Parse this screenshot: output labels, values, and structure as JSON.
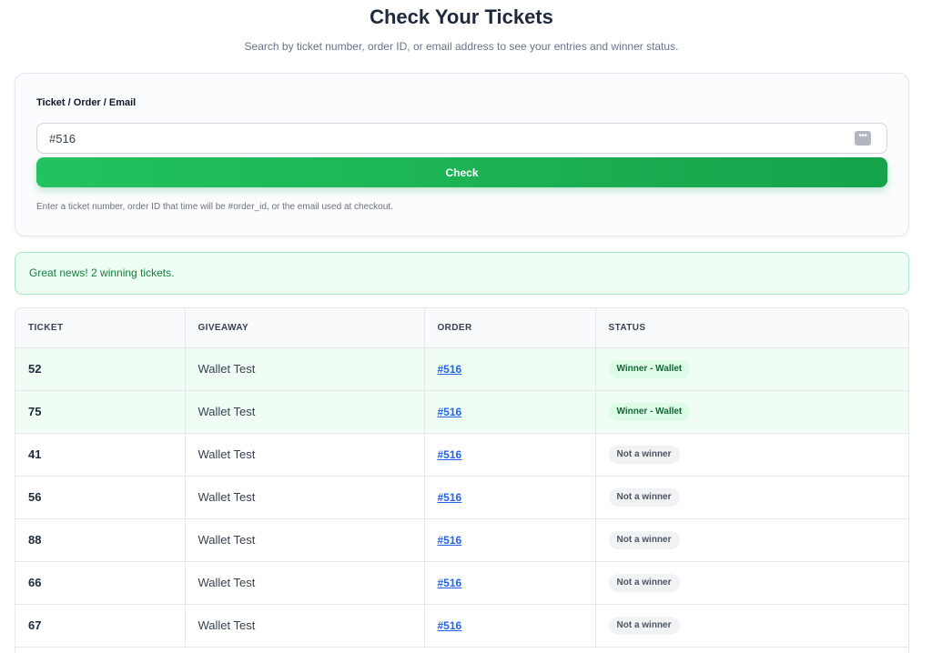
{
  "header": {
    "title": "Check Your Tickets",
    "subtitle": "Search by ticket number, order ID, or email address to see your entries and winner status."
  },
  "search": {
    "label": "Ticket / Order / Email",
    "value": "#516",
    "button_label": "Check",
    "hint": "Enter a ticket number, order ID that time will be #order_id, or the email used at checkout.",
    "icon": "dots-icon"
  },
  "alert": {
    "message": "Great news! 2 winning tickets."
  },
  "table": {
    "columns": [
      "TICKET",
      "GIVEAWAY",
      "ORDER",
      "STATUS"
    ],
    "rows": [
      {
        "ticket": "52",
        "giveaway": "Wallet Test",
        "order": "#516",
        "status": "Winner - Wallet",
        "winner": true
      },
      {
        "ticket": "75",
        "giveaway": "Wallet Test",
        "order": "#516",
        "status": "Winner - Wallet",
        "winner": true
      },
      {
        "ticket": "41",
        "giveaway": "Wallet Test",
        "order": "#516",
        "status": "Not a winner",
        "winner": false
      },
      {
        "ticket": "56",
        "giveaway": "Wallet Test",
        "order": "#516",
        "status": "Not a winner",
        "winner": false
      },
      {
        "ticket": "88",
        "giveaway": "Wallet Test",
        "order": "#516",
        "status": "Not a winner",
        "winner": false
      },
      {
        "ticket": "66",
        "giveaway": "Wallet Test",
        "order": "#516",
        "status": "Not a winner",
        "winner": false
      },
      {
        "ticket": "67",
        "giveaway": "Wallet Test",
        "order": "#516",
        "status": "Not a winner",
        "winner": false
      }
    ]
  },
  "colors": {
    "accent": "#16a34a",
    "link": "#2563eb",
    "winner_row": "#f0fdf4"
  }
}
